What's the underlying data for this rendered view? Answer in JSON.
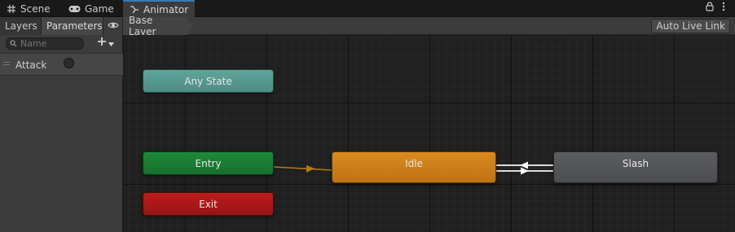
{
  "tabs": [
    {
      "label": "Scene",
      "icon": "grid-icon"
    },
    {
      "label": "Game",
      "icon": "gamepad-icon"
    },
    {
      "label": "Animator",
      "icon": "animator-icon"
    }
  ],
  "window_icons": [
    "lock-icon",
    "kebab-menu-icon"
  ],
  "left_tabs": {
    "layers": "Layers",
    "parameters": "Parameters"
  },
  "breadcrumb": "Base Layer",
  "auto_live_link": "Auto Live Link",
  "search": {
    "placeholder": "Name",
    "value": ""
  },
  "parameters": [
    {
      "name": "Attack",
      "type": "trigger"
    }
  ],
  "states": {
    "any_state": "Any State",
    "entry": "Entry",
    "exit": "Exit",
    "idle": "Idle",
    "slash": "Slash"
  },
  "colors": {
    "any_state": "#5fa59b",
    "entry": "#1f8a3a",
    "exit": "#bd1c1c",
    "idle": "#d98a1f",
    "slash": "#5b5d61",
    "default_transition": "#b77a14",
    "transition": "#ffffff",
    "active_tab_accent": "#3a79bb"
  }
}
